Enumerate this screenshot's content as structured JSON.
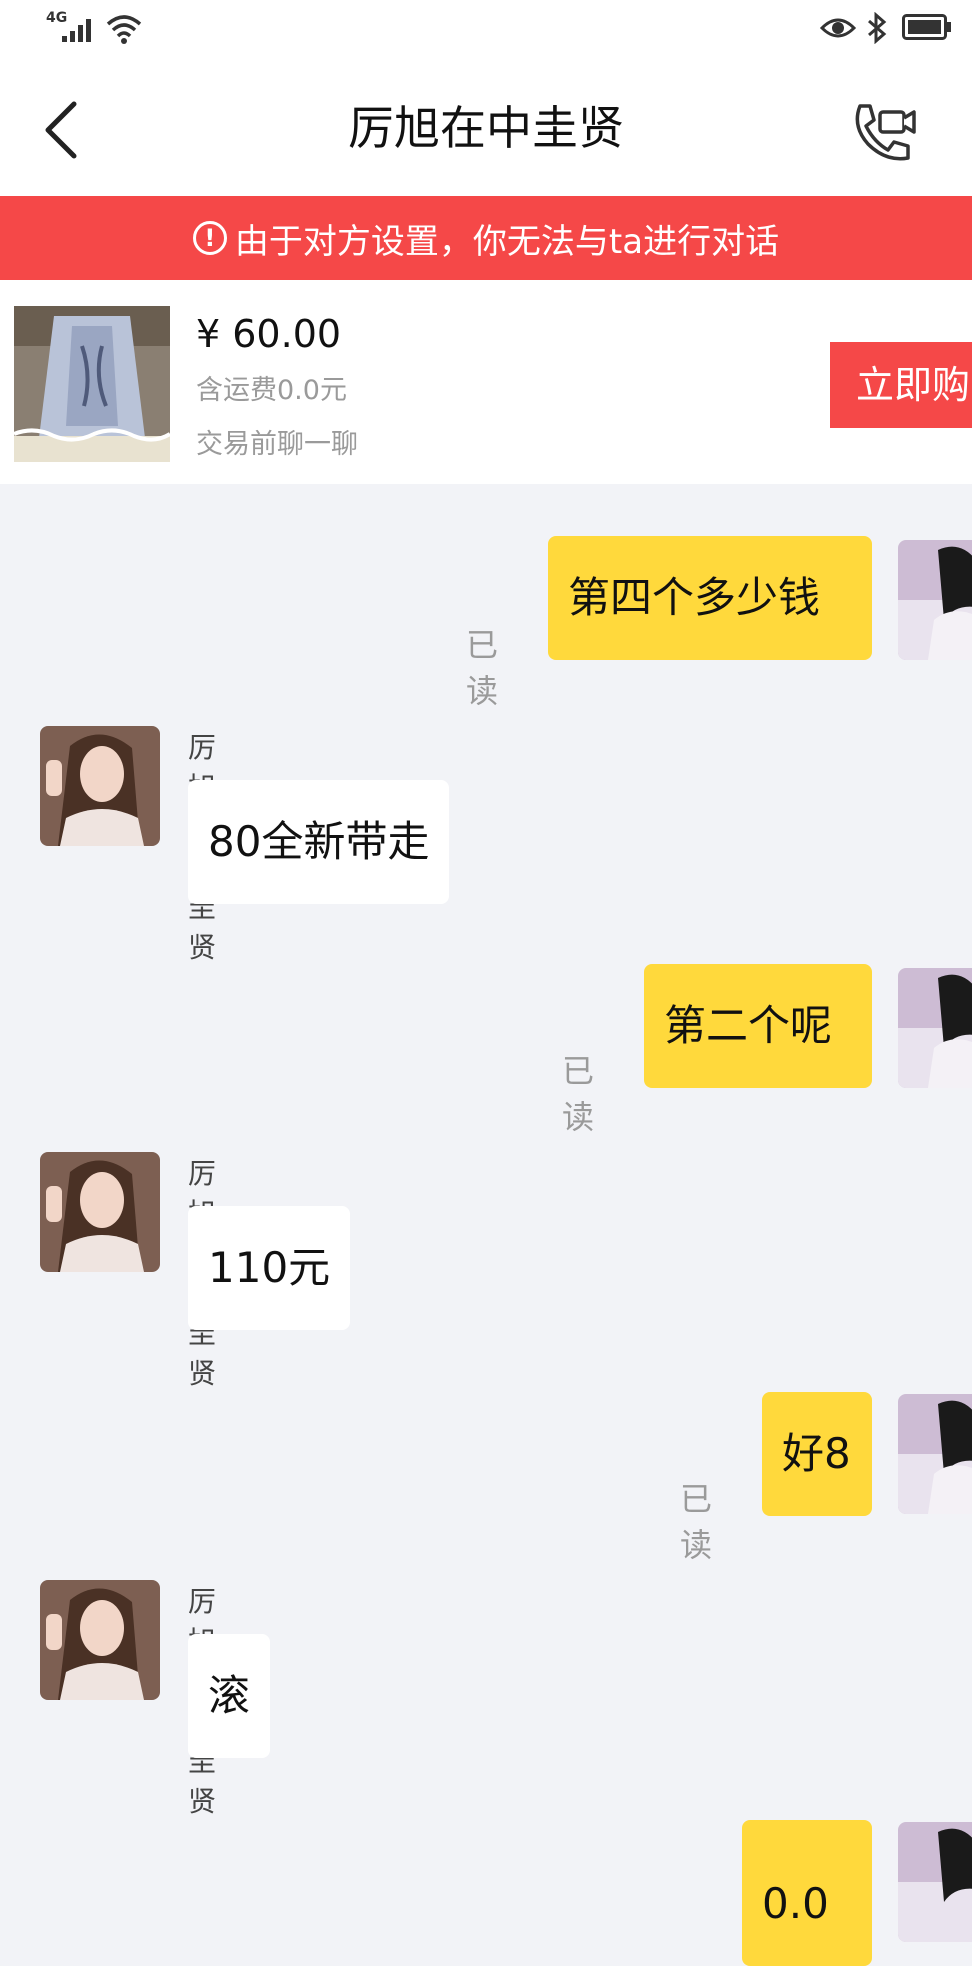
{
  "status_bar": {
    "network": "4G",
    "signal_icon": "signal-icon",
    "wifi_icon": "wifi-icon",
    "eye_icon": "eye-icon",
    "bluetooth_icon": "bluetooth-icon",
    "battery_icon": "battery-icon"
  },
  "nav": {
    "title": "厉旭在中圭贤",
    "back_icon": "chevron-left-icon",
    "call_icon": "phone-video-icon"
  },
  "warning": {
    "icon": "!",
    "text": "由于对方设置，你无法与ta进行对话"
  },
  "product": {
    "price": "¥ 60.00",
    "shipping": "含运费0.0元",
    "chat_hint": "交易前聊一聊",
    "buy_label": "立即购"
  },
  "messages": [
    {
      "from": "me",
      "text": "第四个多少钱",
      "status": "已读"
    },
    {
      "from": "them",
      "sender": "厉旭在中圭贤",
      "text": "80全新带走"
    },
    {
      "from": "me",
      "text": "第二个呢",
      "status": "已读"
    },
    {
      "from": "them",
      "sender": "厉旭在中圭贤",
      "text": "110元"
    },
    {
      "from": "me",
      "text": "好8",
      "status": "已读"
    },
    {
      "from": "them",
      "sender": "厉旭在中圭贤",
      "text": "滚"
    },
    {
      "from": "me",
      "text": "0.0"
    }
  ],
  "colors": {
    "accent_red": "#f54848",
    "my_bubble": "#ffd93c",
    "their_bubble": "#ffffff",
    "chat_bg": "#f2f3f7"
  }
}
